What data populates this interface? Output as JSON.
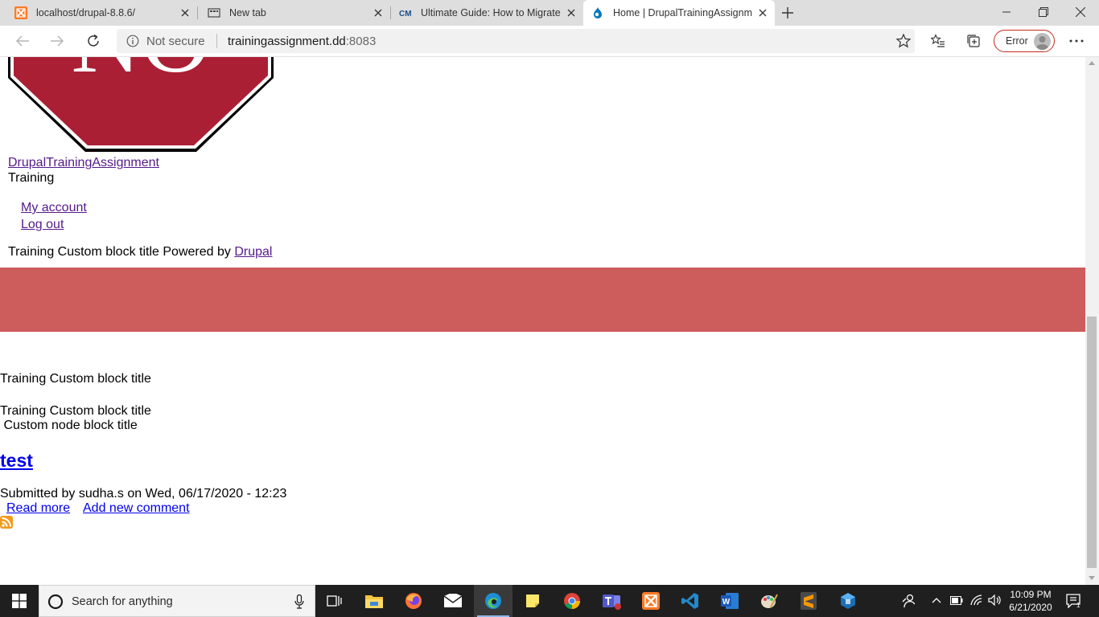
{
  "browser": {
    "tabs": [
      {
        "title": "localhost/drupal-8.8.6/",
        "icon": "xampp-icon",
        "active": false
      },
      {
        "title": "New tab",
        "icon": "new-tab-page-icon",
        "active": false
      },
      {
        "title": "Ultimate Guide: How to Migrate",
        "icon": "cm-icon",
        "active": false
      },
      {
        "title": "Home | DrupalTrainingAssignme",
        "icon": "drupal-icon",
        "active": true
      }
    ],
    "address": {
      "security_label": "Not secure",
      "host": "trainingassignment.dd",
      "port": ":8083"
    },
    "profile_status": "Error"
  },
  "page": {
    "logo_text": "NO",
    "site_name": "DrupalTrainingAssignment",
    "site_slogan": "Training",
    "user_menu": [
      "My account",
      "Log out"
    ],
    "footer_line": {
      "text": "Training Custom block title Powered by ",
      "link": "Drupal"
    },
    "banner_color": "#cd5c5c",
    "blocks": {
      "first": "Training Custom block title",
      "second": "Training Custom block title",
      "third": " Custom node block title"
    },
    "article": {
      "title": "test",
      "submitted": "Submitted by sudha.s on Wed, 06/17/2020 - 12:23",
      "read_more": "Read more",
      "add_comment": "Add new comment"
    },
    "feed_icon": "rss-icon"
  },
  "taskbar": {
    "search_placeholder": "Search for anything",
    "apps": [
      "task-view-icon",
      "file-explorer-icon",
      "firefox-icon",
      "mail-icon",
      "edge-icon",
      "sticky-notes-icon",
      "chrome-icon",
      "teams-icon",
      "xampp-icon",
      "vscode-icon",
      "word-icon",
      "paint-icon",
      "sublime-text-icon",
      "virtualbox-icon"
    ],
    "time": "10:09 PM",
    "date": "6/21/2020"
  }
}
